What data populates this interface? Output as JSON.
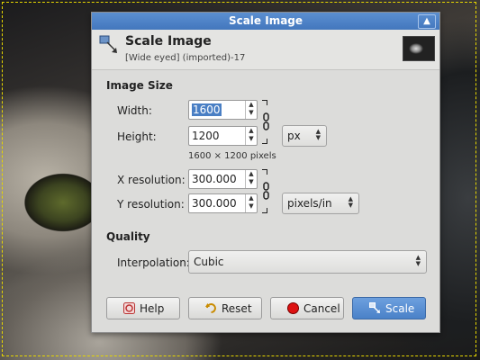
{
  "dialog": {
    "window_title": "Scale Image",
    "header_title": "Scale Image",
    "header_subtitle": "[Wide eyed] (imported)-17"
  },
  "image_size": {
    "section_label": "Image Size",
    "width_label": "Width:",
    "width_value": "1600",
    "height_label": "Height:",
    "height_value": "1200",
    "size_unit": "px",
    "pixel_summary": "1600 × 1200 pixels",
    "x_res_label": "X resolution:",
    "x_res_value": "300.000",
    "y_res_label": "Y resolution:",
    "y_res_value": "300.000",
    "res_unit": "pixels/in"
  },
  "quality": {
    "section_label": "Quality",
    "interp_label": "Interpolation:",
    "interp_value": "Cubic"
  },
  "buttons": {
    "help": "Help",
    "reset": "Reset",
    "cancel": "Cancel",
    "scale": "Scale"
  },
  "colors": {
    "titlebar": "#4a7fc4",
    "selection": "#4a7fc4",
    "marquee": "#e6d600"
  }
}
